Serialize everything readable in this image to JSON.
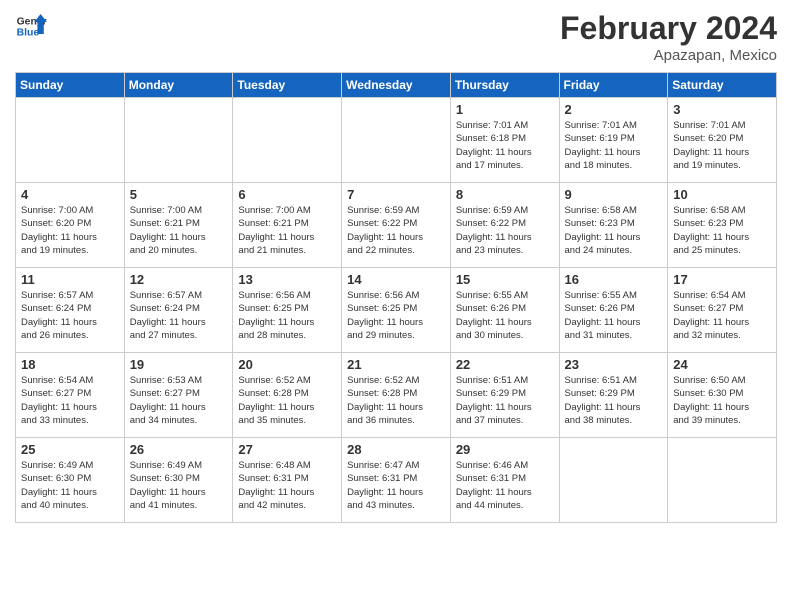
{
  "header": {
    "logo_line1": "General",
    "logo_line2": "Blue",
    "month": "February 2024",
    "location": "Apazapan, Mexico"
  },
  "days_of_week": [
    "Sunday",
    "Monday",
    "Tuesday",
    "Wednesday",
    "Thursday",
    "Friday",
    "Saturday"
  ],
  "weeks": [
    [
      {
        "day": "",
        "info": ""
      },
      {
        "day": "",
        "info": ""
      },
      {
        "day": "",
        "info": ""
      },
      {
        "day": "",
        "info": ""
      },
      {
        "day": "1",
        "info": "Sunrise: 7:01 AM\nSunset: 6:18 PM\nDaylight: 11 hours\nand 17 minutes."
      },
      {
        "day": "2",
        "info": "Sunrise: 7:01 AM\nSunset: 6:19 PM\nDaylight: 11 hours\nand 18 minutes."
      },
      {
        "day": "3",
        "info": "Sunrise: 7:01 AM\nSunset: 6:20 PM\nDaylight: 11 hours\nand 19 minutes."
      }
    ],
    [
      {
        "day": "4",
        "info": "Sunrise: 7:00 AM\nSunset: 6:20 PM\nDaylight: 11 hours\nand 19 minutes."
      },
      {
        "day": "5",
        "info": "Sunrise: 7:00 AM\nSunset: 6:21 PM\nDaylight: 11 hours\nand 20 minutes."
      },
      {
        "day": "6",
        "info": "Sunrise: 7:00 AM\nSunset: 6:21 PM\nDaylight: 11 hours\nand 21 minutes."
      },
      {
        "day": "7",
        "info": "Sunrise: 6:59 AM\nSunset: 6:22 PM\nDaylight: 11 hours\nand 22 minutes."
      },
      {
        "day": "8",
        "info": "Sunrise: 6:59 AM\nSunset: 6:22 PM\nDaylight: 11 hours\nand 23 minutes."
      },
      {
        "day": "9",
        "info": "Sunrise: 6:58 AM\nSunset: 6:23 PM\nDaylight: 11 hours\nand 24 minutes."
      },
      {
        "day": "10",
        "info": "Sunrise: 6:58 AM\nSunset: 6:23 PM\nDaylight: 11 hours\nand 25 minutes."
      }
    ],
    [
      {
        "day": "11",
        "info": "Sunrise: 6:57 AM\nSunset: 6:24 PM\nDaylight: 11 hours\nand 26 minutes."
      },
      {
        "day": "12",
        "info": "Sunrise: 6:57 AM\nSunset: 6:24 PM\nDaylight: 11 hours\nand 27 minutes."
      },
      {
        "day": "13",
        "info": "Sunrise: 6:56 AM\nSunset: 6:25 PM\nDaylight: 11 hours\nand 28 minutes."
      },
      {
        "day": "14",
        "info": "Sunrise: 6:56 AM\nSunset: 6:25 PM\nDaylight: 11 hours\nand 29 minutes."
      },
      {
        "day": "15",
        "info": "Sunrise: 6:55 AM\nSunset: 6:26 PM\nDaylight: 11 hours\nand 30 minutes."
      },
      {
        "day": "16",
        "info": "Sunrise: 6:55 AM\nSunset: 6:26 PM\nDaylight: 11 hours\nand 31 minutes."
      },
      {
        "day": "17",
        "info": "Sunrise: 6:54 AM\nSunset: 6:27 PM\nDaylight: 11 hours\nand 32 minutes."
      }
    ],
    [
      {
        "day": "18",
        "info": "Sunrise: 6:54 AM\nSunset: 6:27 PM\nDaylight: 11 hours\nand 33 minutes."
      },
      {
        "day": "19",
        "info": "Sunrise: 6:53 AM\nSunset: 6:27 PM\nDaylight: 11 hours\nand 34 minutes."
      },
      {
        "day": "20",
        "info": "Sunrise: 6:52 AM\nSunset: 6:28 PM\nDaylight: 11 hours\nand 35 minutes."
      },
      {
        "day": "21",
        "info": "Sunrise: 6:52 AM\nSunset: 6:28 PM\nDaylight: 11 hours\nand 36 minutes."
      },
      {
        "day": "22",
        "info": "Sunrise: 6:51 AM\nSunset: 6:29 PM\nDaylight: 11 hours\nand 37 minutes."
      },
      {
        "day": "23",
        "info": "Sunrise: 6:51 AM\nSunset: 6:29 PM\nDaylight: 11 hours\nand 38 minutes."
      },
      {
        "day": "24",
        "info": "Sunrise: 6:50 AM\nSunset: 6:30 PM\nDaylight: 11 hours\nand 39 minutes."
      }
    ],
    [
      {
        "day": "25",
        "info": "Sunrise: 6:49 AM\nSunset: 6:30 PM\nDaylight: 11 hours\nand 40 minutes."
      },
      {
        "day": "26",
        "info": "Sunrise: 6:49 AM\nSunset: 6:30 PM\nDaylight: 11 hours\nand 41 minutes."
      },
      {
        "day": "27",
        "info": "Sunrise: 6:48 AM\nSunset: 6:31 PM\nDaylight: 11 hours\nand 42 minutes."
      },
      {
        "day": "28",
        "info": "Sunrise: 6:47 AM\nSunset: 6:31 PM\nDaylight: 11 hours\nand 43 minutes."
      },
      {
        "day": "29",
        "info": "Sunrise: 6:46 AM\nSunset: 6:31 PM\nDaylight: 11 hours\nand 44 minutes."
      },
      {
        "day": "",
        "info": ""
      },
      {
        "day": "",
        "info": ""
      }
    ]
  ]
}
